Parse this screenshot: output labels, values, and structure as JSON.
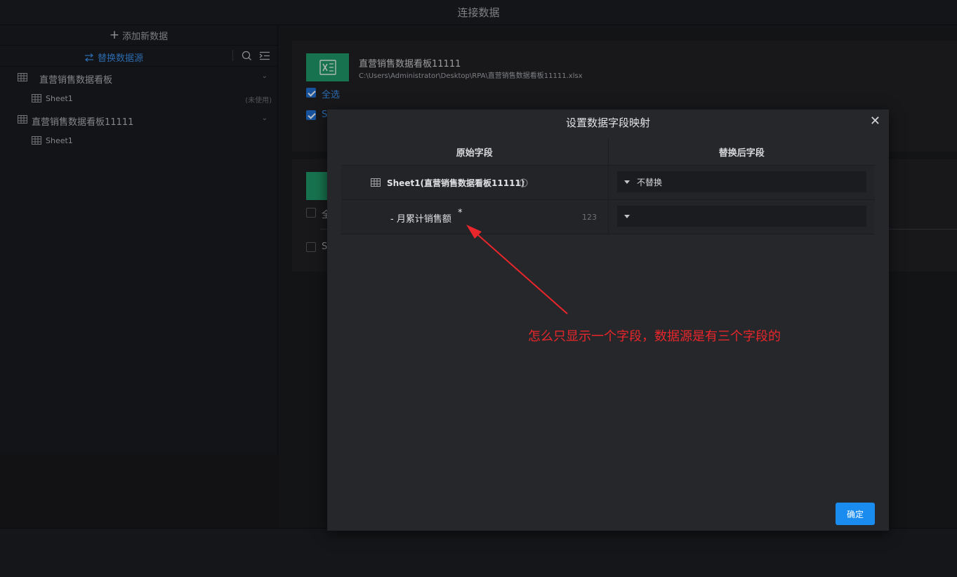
{
  "window": {
    "title": "连接数据"
  },
  "sidebar": {
    "add_label": "添加新数据",
    "switch_label": "替换数据源",
    "items": [
      {
        "label": "直营销售数据看板",
        "type": "workbook"
      },
      {
        "label": "Sheet1",
        "meta": "(未使用)",
        "type": "sheet"
      },
      {
        "label": "直营销售数据看板11111",
        "type": "workbook"
      },
      {
        "label": "Sheet1",
        "type": "sheet"
      }
    ]
  },
  "main": {
    "card1": {
      "title": "直营销售数据看板11111",
      "path": "C:\\Users\\Administrator\\Desktop\\RPA\\直营销售数据看板11111.xlsx",
      "select_all": "全选",
      "sheet_label": "S"
    },
    "card2": {
      "select_all": "全",
      "sheet_label": "S"
    }
  },
  "modal": {
    "title": "设置数据字段映射",
    "col_original": "原始字段",
    "col_replaced": "替换后字段",
    "sheet_row": {
      "label": "Sheet1(直营销售数据看板11111)",
      "select_value": "不替换"
    },
    "field_row": {
      "label": "- 月累计销售额",
      "required": "*",
      "type_badge": "123",
      "select_value": ""
    },
    "confirm_label": "确定"
  },
  "annotation": {
    "text": "怎么只显示一个字段，数据源是有三个字段的",
    "color": "#e8262b"
  }
}
